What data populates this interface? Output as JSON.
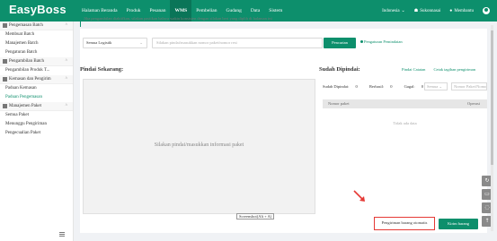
{
  "app": {
    "logo": "EasyBoss"
  },
  "nav": {
    "items": [
      "Halaman Beranda",
      "Produk",
      "Pesanan",
      "WMS",
      "Pembelian",
      "Gudang",
      "Data",
      "Sistem"
    ],
    "active": "WMS"
  },
  "topbar": {
    "language": "Indonesia",
    "org": "Sukonnasai",
    "help": "Membantu"
  },
  "notice": "Jika pengambilan diaktifkan, silakan pastikan bahwa waktu konsisten dengan silakan beri yang diplih di halaman ini",
  "sidebar": {
    "groups": [
      {
        "label": "Pengemasan Batch",
        "items": [
          "Membuat Batch",
          "Manajemen Batch",
          "Pengaturan Batch"
        ]
      },
      {
        "label": "Pengambilan Batch",
        "items": [
          "Pengambilan Produk T..."
        ]
      },
      {
        "label": "Kemasan dan Pengirim",
        "items": [
          "Paduan Kemasan",
          "Paduan Pengemasan"
        ]
      },
      {
        "label": "Manajemen Paket",
        "items": [
          "Semua Paket",
          "Menunggu Pengiriman",
          "Pengecualian Paket"
        ]
      }
    ],
    "active_item": "Paduan Pengemasan"
  },
  "filter": {
    "logistics_select": "Semua Logistik",
    "scan_placeholder": "Silakan pindai/masukkan nomor paket/nomor resi",
    "search_button": "Pencarian",
    "settings_link": "Pengaturan Pemindaian"
  },
  "left_panel": {
    "title": "Pindai Sekarang:",
    "placeholder": "Silakan pindai/masukkan informasi paket",
    "screenshot_tip": "Screenshot(Alt + A)"
  },
  "right_panel": {
    "title": "Sudah Dipindai:",
    "links": [
      "Pindai Catatan",
      "Cetak tagihan pengiriman"
    ],
    "stats": {
      "scanned_label": "Sudah Dipindai:",
      "scanned": "0",
      "success_label": "Berhasil:",
      "success": "0",
      "failed_label": "Gagal:",
      "failed": "0"
    },
    "status_select": "Semua",
    "search_placeholder": "Nomor Paket/Nomor R",
    "columns": [
      "Nomor paket",
      "Operasi"
    ],
    "empty_text": "Tidak ada data"
  },
  "footer": {
    "ship_button": "Pengiriman barang otomatis",
    "finish_button": "Kirim barang"
  },
  "colors": {
    "brand": "#0d8f6c",
    "highlight": "#e53935"
  }
}
